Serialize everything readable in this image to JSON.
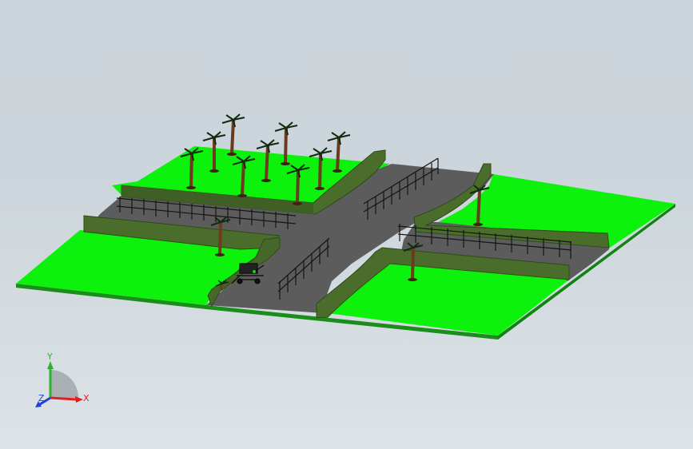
{
  "viewport": {
    "background_top": "#cbd4da",
    "background_bottom": "#dde3e7"
  },
  "scene": {
    "model": "landscape-crossroads",
    "colors": {
      "grass": "#0df20d",
      "grass_edge": "#1a8d1a",
      "road": "#5c5c5c",
      "hedge": "#4a6d2c",
      "hedge_dark": "#2f4a1a",
      "fence": "#151515",
      "trunk": "#6b3b1e",
      "palm_leaf": "#0f2a0f"
    },
    "palm_tree_count": 13,
    "icons": [
      "palm-tree-icon",
      "fence-icon",
      "hedge-icon",
      "vehicle-icon"
    ]
  },
  "triad": {
    "x_label": "X",
    "y_label": "Y",
    "z_label": "Z",
    "x_color": "#e02020",
    "y_color": "#2bb52b",
    "z_color": "#2040e0"
  }
}
